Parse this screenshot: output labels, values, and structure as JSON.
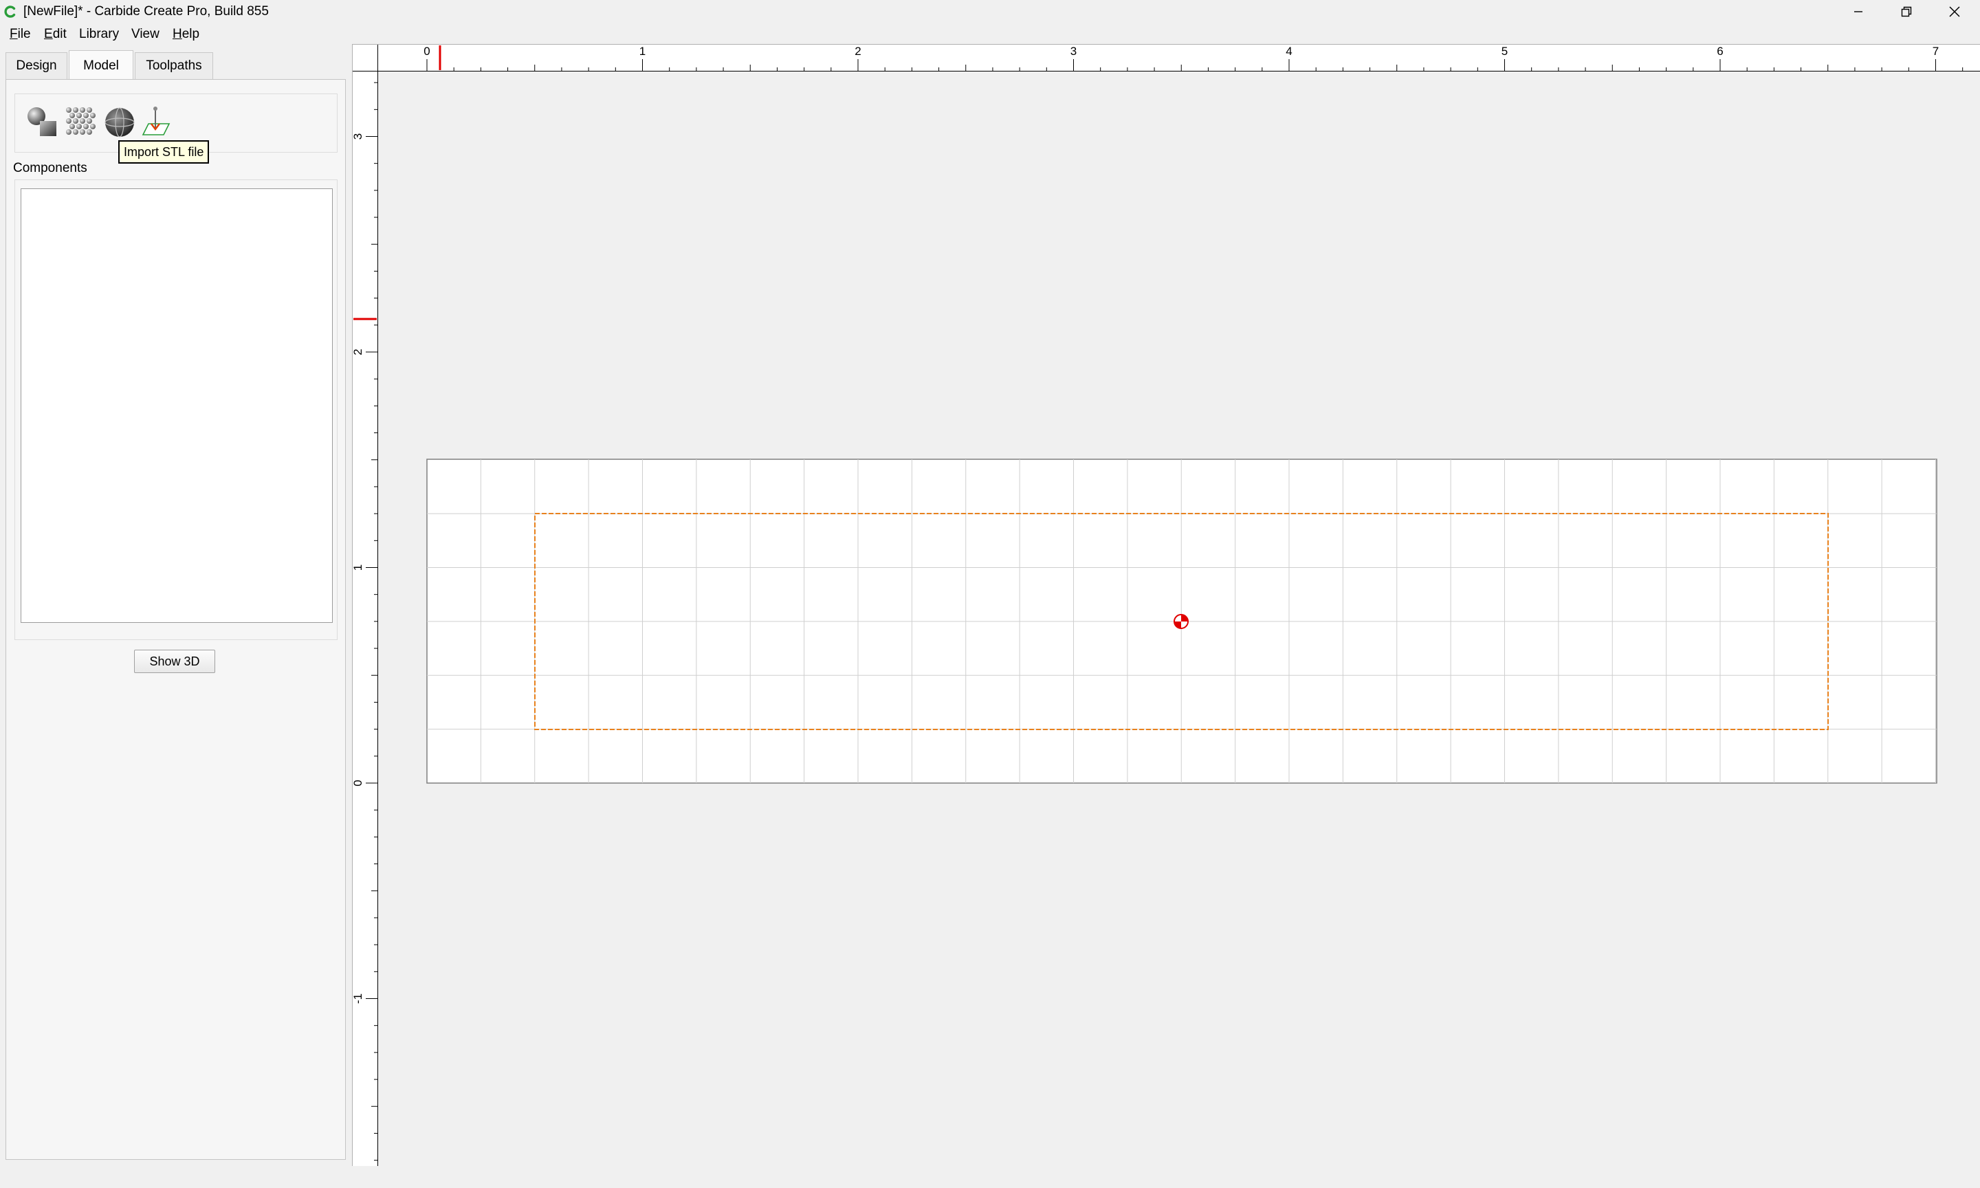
{
  "window": {
    "title": "[NewFile]* - Carbide Create Pro, Build 855",
    "icons": {
      "app": "carbide-logo-icon",
      "minimize": "minimize-icon",
      "maximize": "restore-icon",
      "close": "close-icon"
    }
  },
  "menu": [
    {
      "label": "File",
      "mnemonic": "F",
      "rest": "ile"
    },
    {
      "label": "Edit",
      "mnemonic": "E",
      "rest": "dit"
    },
    {
      "label": "Library",
      "mnemonic": "",
      "rest": "Library"
    },
    {
      "label": "View",
      "mnemonic": "",
      "rest": "View"
    },
    {
      "label": "Help",
      "mnemonic": "H",
      "rest": "elp"
    }
  ],
  "tabs": [
    {
      "label": "Design",
      "active": false
    },
    {
      "label": "Model",
      "active": true
    },
    {
      "label": "Toolpaths",
      "active": false
    }
  ],
  "model_tools": [
    {
      "name": "shape-to-model-icon"
    },
    {
      "name": "texture-grid-icon"
    },
    {
      "name": "sphere-icon"
    },
    {
      "name": "import-stl-icon"
    }
  ],
  "tooltip": "Import STL file",
  "components": {
    "label": "Components",
    "items": []
  },
  "show3d_label": "Show 3D",
  "ruler": {
    "x_ticks": [
      "0",
      "1",
      "2",
      "3",
      "4",
      "5",
      "6",
      "7"
    ],
    "y_ticks": [
      "3",
      "2",
      "1",
      "0",
      "-1"
    ]
  },
  "colors": {
    "stock_outline": "#7f7f7f",
    "grid": "#cfcfcf",
    "job_boundary": "#e8821e",
    "origin_marker": "#e00000",
    "cursor_indicator": "#e00000",
    "accent_green": "#2a9d3a"
  }
}
